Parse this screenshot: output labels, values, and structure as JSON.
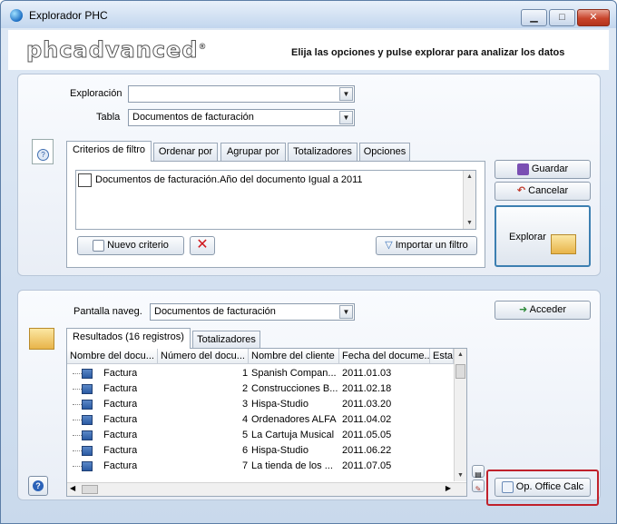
{
  "window": {
    "title": "Explorador PHC"
  },
  "banner": {
    "logo": "phcadvanced",
    "logo_mark": "®",
    "subtitle": "Elija las opciones y pulse explorar para analizar los datos"
  },
  "top": {
    "exploracion_label": "Exploración",
    "exploracion_value": "",
    "tabla_label": "Tabla",
    "tabla_value": "Documentos de facturación",
    "tabs": [
      {
        "label": "Criterios de filtro"
      },
      {
        "label": "Ordenar por"
      },
      {
        "label": "Agrupar por"
      },
      {
        "label": "Totalizadores"
      },
      {
        "label": "Opciones"
      }
    ],
    "criterion": "Documentos de facturación.Año del documento Igual a 2011",
    "nuevo_criterio": "Nuevo criterio",
    "importar_filtro": "Importar un filtro",
    "guardar": "Guardar",
    "cancelar": "Cancelar",
    "explorar": "Explorar"
  },
  "bottom": {
    "pantalla_label": "Pantalla naveg.",
    "pantalla_value": "Documentos de facturación",
    "acceder": "Acceder",
    "tabs": [
      {
        "label": "Resultados (16 registros)"
      },
      {
        "label": "Totalizadores"
      }
    ],
    "columns": [
      "Nombre del docu...",
      "Número del docu...",
      "Nombre del cliente",
      "Fecha del docume...",
      "Estal"
    ],
    "rows": [
      {
        "doc": "Factura",
        "num": "1",
        "client": "Spanish Compan...",
        "date": "2011.01.03"
      },
      {
        "doc": "Factura",
        "num": "2",
        "client": "Construcciones B...",
        "date": "2011.02.18"
      },
      {
        "doc": "Factura",
        "num": "3",
        "client": "Hispa-Studio",
        "date": "2011.03.20"
      },
      {
        "doc": "Factura",
        "num": "4",
        "client": "Ordenadores ALFA",
        "date": "2011.04.02"
      },
      {
        "doc": "Factura",
        "num": "5",
        "client": "La Cartuja Musical",
        "date": "2011.05.05"
      },
      {
        "doc": "Factura",
        "num": "6",
        "client": "Hispa-Studio",
        "date": "2011.06.22"
      },
      {
        "doc": "Factura",
        "num": "7",
        "client": "La tienda de los ...",
        "date": "2011.07.05"
      }
    ],
    "office_calc": "Op. Office Calc"
  }
}
